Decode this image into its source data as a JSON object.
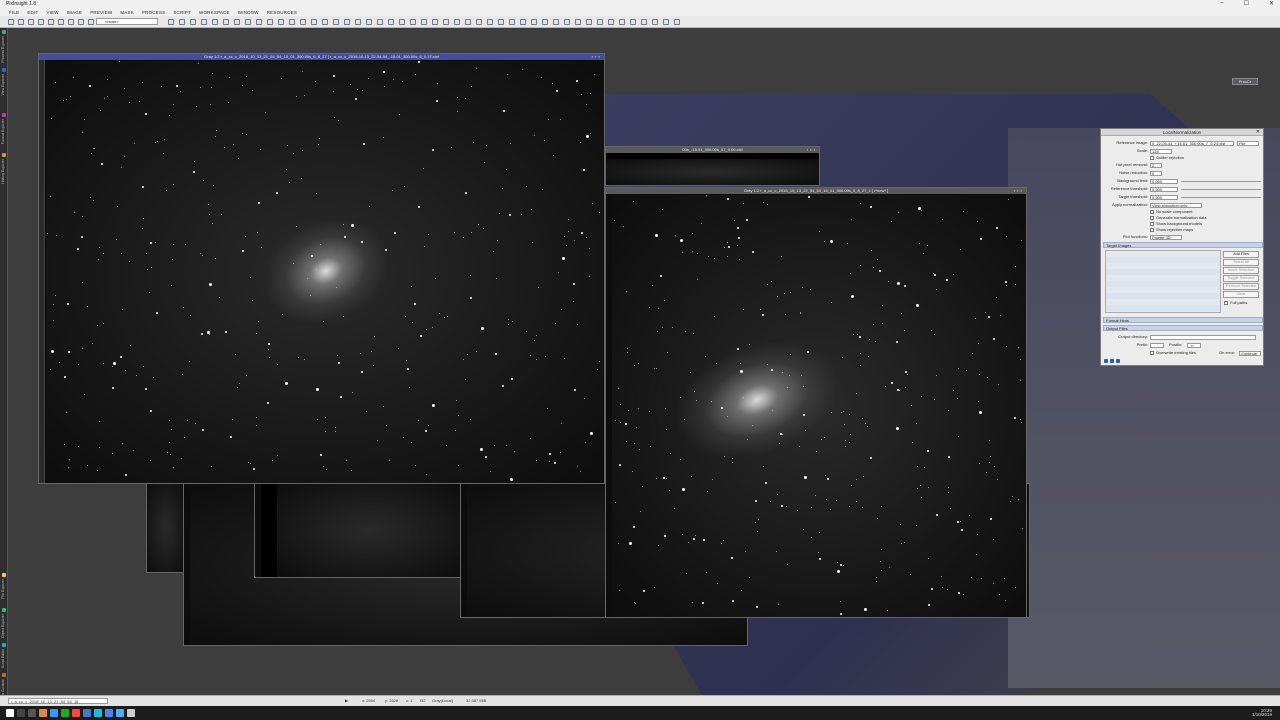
{
  "app": {
    "title": "PixInsight 1.8",
    "window_controls": [
      "–",
      "☐",
      "✕"
    ]
  },
  "menu": [
    "FILE",
    "EDIT",
    "VIEW",
    "IMAGE",
    "PREVIEW",
    "MASK",
    "PROCESS",
    "SCRIPT",
    "WORKSPACE",
    "WINDOW",
    "RESOURCES"
  ],
  "toolbar": {
    "mask_select": "<none>"
  },
  "workspace": {
    "badge": "ProcCr"
  },
  "left_rail": {
    "tabs": [
      "Process Explorer",
      "View Explorer",
      "Format Explorer",
      "History Explorer",
      "File Explorer",
      "Object Explorer",
      "Script Editor",
      "Process Console"
    ]
  },
  "image_windows": {
    "main_title": "Gray 1:2 r_a_cc_c_2018_10_13_21_54_54_15_01_300.00s_6_8_27 [ r_a_cc_c_2018-10-13_22-54-54_-15.01_300.00s_6_0.37.xisf",
    "mid_title": "00s_-15.01_300.00s_37_0.00.xisf",
    "right_title": "Gray 1:2 r_a_cc_c_2018_10_13_22_54_54_15_01_300.00s_6_8_27_1 [ r*new* ]"
  },
  "dialog": {
    "title": "LocalNormalization",
    "close": "✕",
    "reference_image_label": "Reference image:",
    "reference_image_value": "0_22-09-44_+15-01_300.00s_7_0.24.xisf",
    "reference_image_mode": "File",
    "scale_label": "Scale:",
    "scale_value": "128",
    "outlier_label": "Outlier rejection",
    "hot_pixel_label": "Hot pixel removal:",
    "hot_pixel_value": "2",
    "noise_label": "Noise reduction:",
    "noise_value": "0",
    "bg_limit_label": "Background limit:",
    "bg_limit_value": "0.050",
    "ref_threshold_label": "Reference threshold:",
    "ref_threshold_value": "0.500",
    "target_threshold_label": "Target threshold:",
    "target_threshold_value": "0.500",
    "apply_label": "Apply normalization:",
    "apply_value": "View execution only",
    "checkboxes": [
      "No scale component",
      "Generate normalization data",
      "Show background models",
      "Show rejection maps"
    ],
    "plot_label": "Plot functions:",
    "plot_value": "Palette 3D",
    "target_images_section": "Target Images",
    "side_buttons": [
      "Add Files",
      "Select All",
      "Invert Selection",
      "Toggle Selected",
      "Remove Selected",
      "Clear"
    ],
    "full_paths_label": "Full paths",
    "format_hints_section": "Format Hints",
    "output_files_section": "Output Files",
    "output_dir_label": "Output directory:",
    "prefix_label": "Prefix:",
    "postfix_label": "Postfix:",
    "postfix_value": "_n",
    "overwrite_label": "Overwrite existing files",
    "on_error_label": "On error:",
    "on_error_value": "Continue"
  },
  "statusbar": {
    "image_select": "r_a_cc_c_2018_10_13_21_54_54_15",
    "play": "▶",
    "x": "x: 2554",
    "y": "y: 2528",
    "zoom": "z: 1",
    "channel": "f32",
    "mode": "Gray(Local)",
    "mem": "32.387 MiB"
  },
  "taskbar": {
    "time": "10:29",
    "date": "1/10/2019"
  }
}
